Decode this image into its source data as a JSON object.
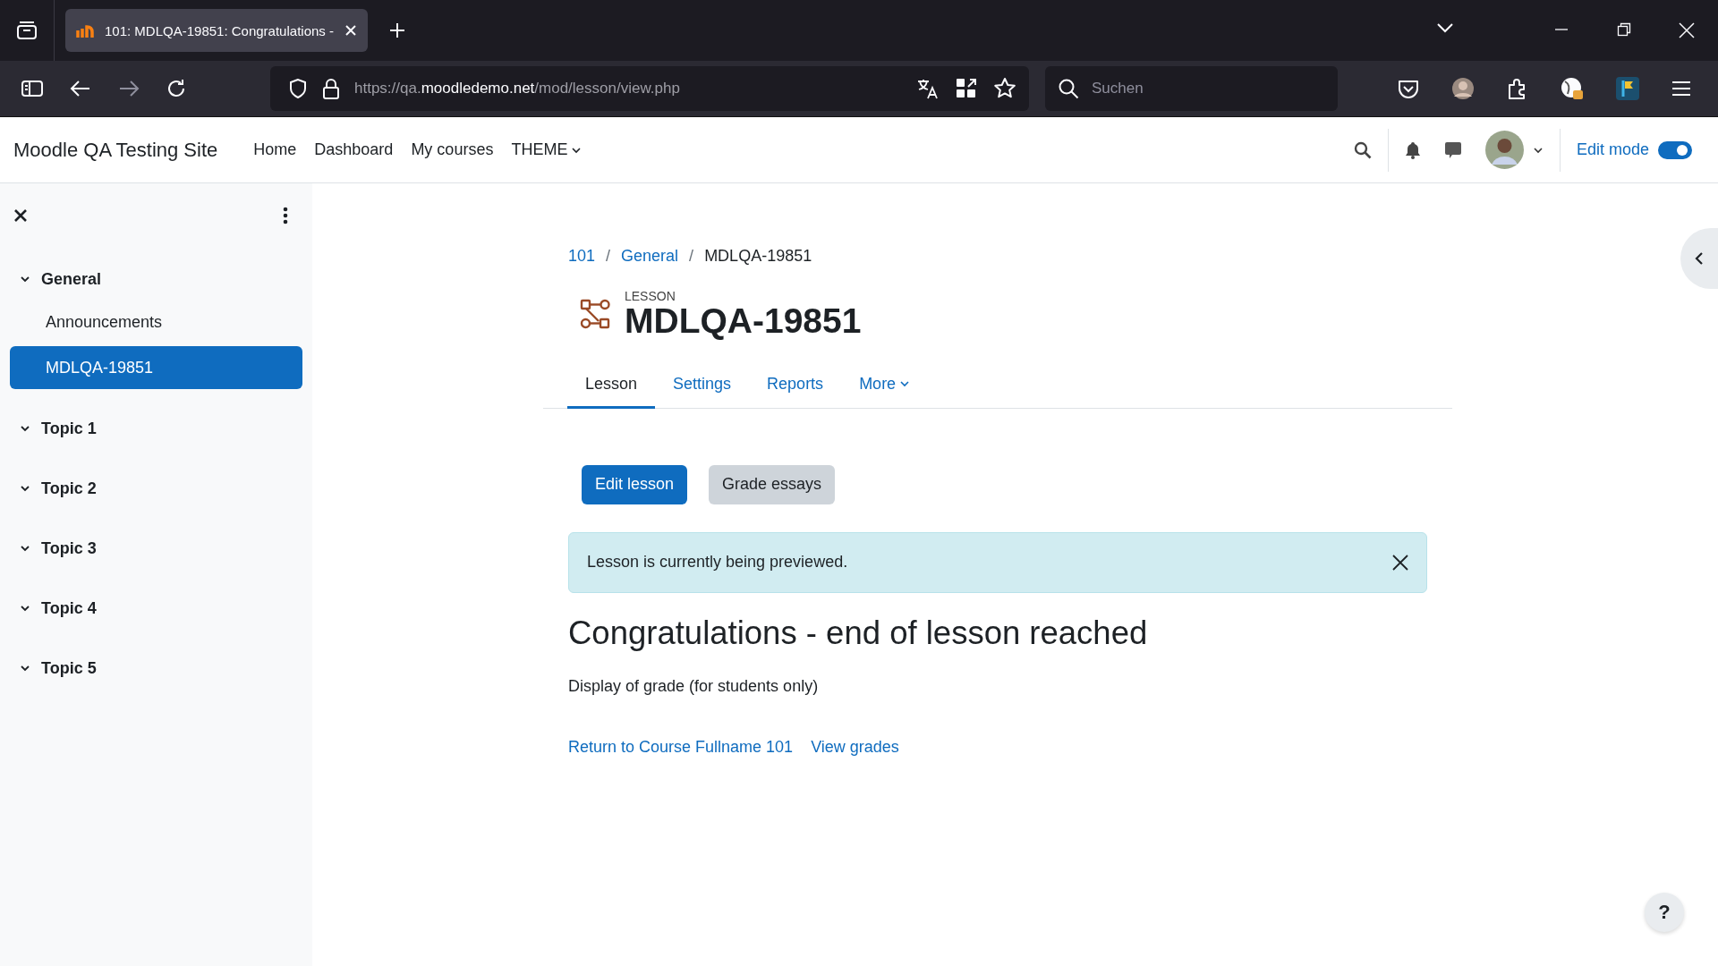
{
  "browser": {
    "tab_title": "101: MDLQA-19851: Congratulations -",
    "url": {
      "prefix": "https://qa.",
      "host": "moodledemo.net",
      "path": "/mod/lesson/view.php"
    },
    "search": {
      "placeholder": "Suchen"
    }
  },
  "site": {
    "name": "Moodle QA Testing Site",
    "nav": [
      {
        "label": "Home",
        "dropdown": false
      },
      {
        "label": "Dashboard",
        "dropdown": false
      },
      {
        "label": "My courses",
        "dropdown": false
      },
      {
        "label": "THEME",
        "dropdown": true
      }
    ],
    "edit_mode": {
      "label": "Edit mode",
      "on": true
    }
  },
  "course_index": {
    "sections": [
      {
        "title": "General",
        "expanded": true,
        "items": [
          {
            "label": "Announcements",
            "selected": false
          },
          {
            "label": "MDLQA-19851",
            "selected": true
          }
        ]
      },
      {
        "title": "Topic 1",
        "expanded": true
      },
      {
        "title": "Topic 2",
        "expanded": true
      },
      {
        "title": "Topic 3",
        "expanded": true
      },
      {
        "title": "Topic 4",
        "expanded": true
      },
      {
        "title": "Topic 5",
        "expanded": true
      }
    ]
  },
  "breadcrumb": [
    {
      "label": "101",
      "link": true
    },
    {
      "separator_before": "/",
      "label": "General",
      "link": true
    },
    {
      "separator_before": "/",
      "label": "MDLQA-19851",
      "link": false
    }
  ],
  "activity": {
    "type_label": "LESSON",
    "title": "MDLQA-19851"
  },
  "tabs": [
    {
      "label": "Lesson",
      "selected": true,
      "dropdown": false
    },
    {
      "label": "Settings",
      "selected": false,
      "dropdown": false
    },
    {
      "label": "Reports",
      "selected": false,
      "dropdown": false
    },
    {
      "label": "More",
      "selected": false,
      "dropdown": true
    }
  ],
  "buttons": [
    {
      "label": "Edit lesson",
      "kind": "primary"
    },
    {
      "label": "Grade essays",
      "kind": "secondary"
    }
  ],
  "alert": {
    "text": "Lesson is currently being previewed."
  },
  "heading": "Congratulations - end of lesson reached",
  "grade_note": "Display of grade (for students only)",
  "links": [
    {
      "label": "Return to Course Fullname 101"
    },
    {
      "label": "View grades"
    }
  ],
  "help": {
    "label": "?"
  }
}
